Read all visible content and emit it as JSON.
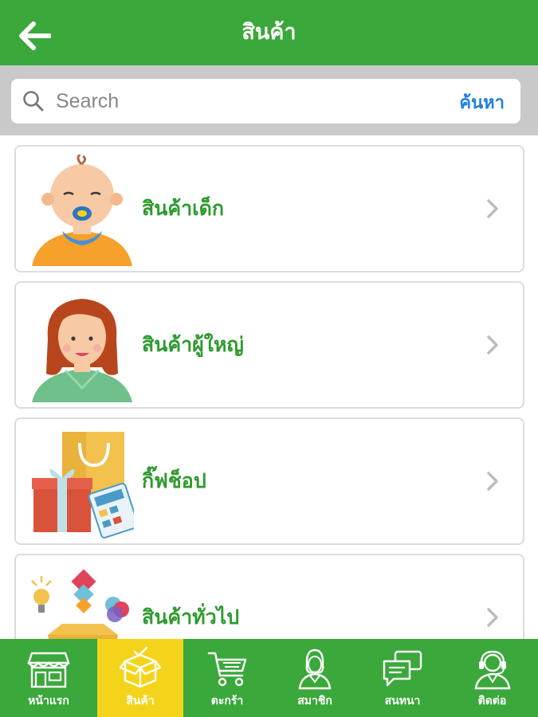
{
  "header": {
    "title": "สินค้า",
    "back_icon": "arrow-left-icon",
    "color": "#3aa83a"
  },
  "search": {
    "placeholder": "Search",
    "button_label": "ค้นหา",
    "button_color": "#1e7ee0"
  },
  "categories": [
    {
      "label": "สินค้าเด็ก",
      "icon": "baby-icon"
    },
    {
      "label": "สินค้าผู้ใหญ่",
      "icon": "woman-icon"
    },
    {
      "label": "กิ๊ฟช็อป",
      "icon": "gift-shop-icon"
    },
    {
      "label": "สินค้าทั่วไป",
      "icon": "general-goods-icon"
    }
  ],
  "bottom_nav": {
    "active_color": "#f4d41b",
    "items": [
      {
        "label": "หน้าแรก",
        "icon": "storefront-icon",
        "active": false
      },
      {
        "label": "สินค้า",
        "icon": "box-icon",
        "active": true
      },
      {
        "label": "ตะกร้า",
        "icon": "cart-icon",
        "active": false
      },
      {
        "label": "สมาชิก",
        "icon": "member-icon",
        "active": false
      },
      {
        "label": "สนทนา",
        "icon": "chat-icon",
        "active": false
      },
      {
        "label": "ติดต่อ",
        "icon": "support-icon",
        "active": false
      }
    ]
  }
}
